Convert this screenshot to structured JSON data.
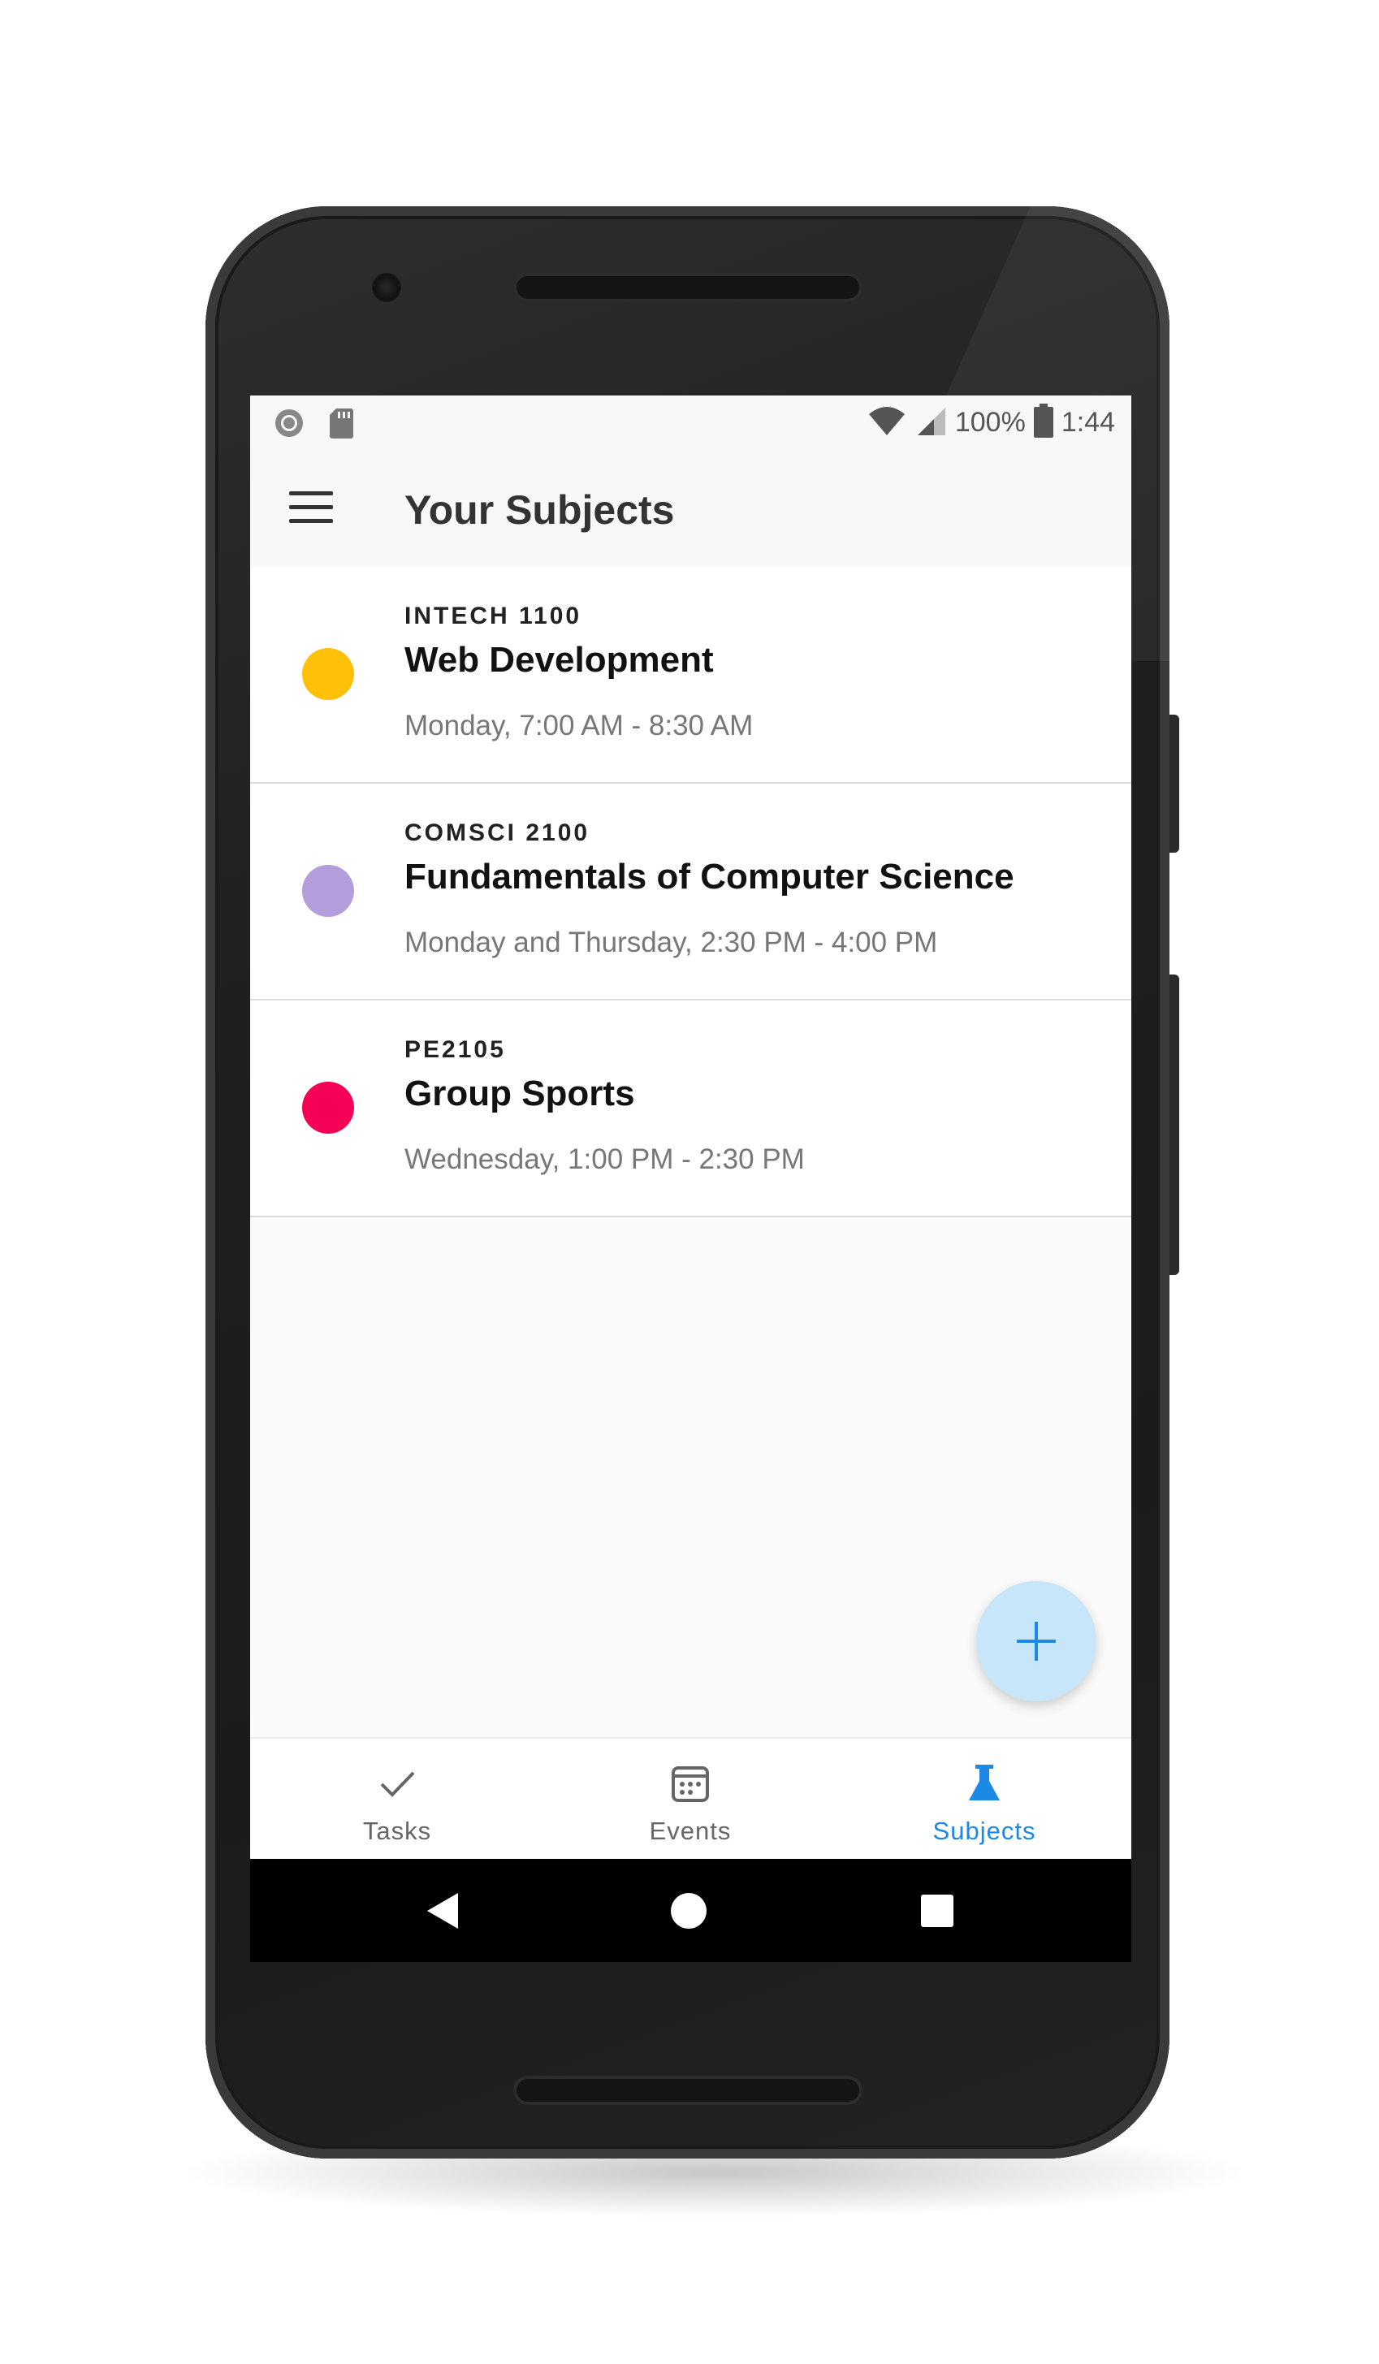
{
  "status_bar": {
    "battery_percent": "100%",
    "time": "1:44",
    "left_icons": [
      "record-icon",
      "sd-card-icon"
    ],
    "right_icons": [
      "wifi-icon",
      "signal-icon",
      "battery-icon"
    ]
  },
  "app_bar": {
    "menu_icon": "menu-icon",
    "title": "Your Subjects"
  },
  "subjects": [
    {
      "code": "INTECH 1100",
      "name": "Web Development",
      "schedule": "Monday, 7:00 AM - 8:30 AM",
      "color": "#FFC107"
    },
    {
      "code": "COMSCI 2100",
      "name": "Fundamentals of Computer Science",
      "schedule": "Monday and Thursday, 2:30 PM - 4:00 PM",
      "color": "#B39DDB"
    },
    {
      "code": "PE2105",
      "name": "Group Sports",
      "schedule": "Wednesday, 1:00 PM - 2:30 PM",
      "color": "#F50057"
    }
  ],
  "fab": {
    "icon": "plus-icon",
    "color": "#C8E6FA",
    "icon_color": "#1E88E5"
  },
  "bottom_nav": {
    "items": [
      {
        "label": "Tasks",
        "icon": "check-icon",
        "active": false
      },
      {
        "label": "Events",
        "icon": "calendar-icon",
        "active": false
      },
      {
        "label": "Subjects",
        "icon": "flask-icon",
        "active": true
      }
    ],
    "active_color": "#1E88E5"
  },
  "system_nav": {
    "icons": [
      "back-icon",
      "home-icon",
      "recents-icon"
    ]
  }
}
